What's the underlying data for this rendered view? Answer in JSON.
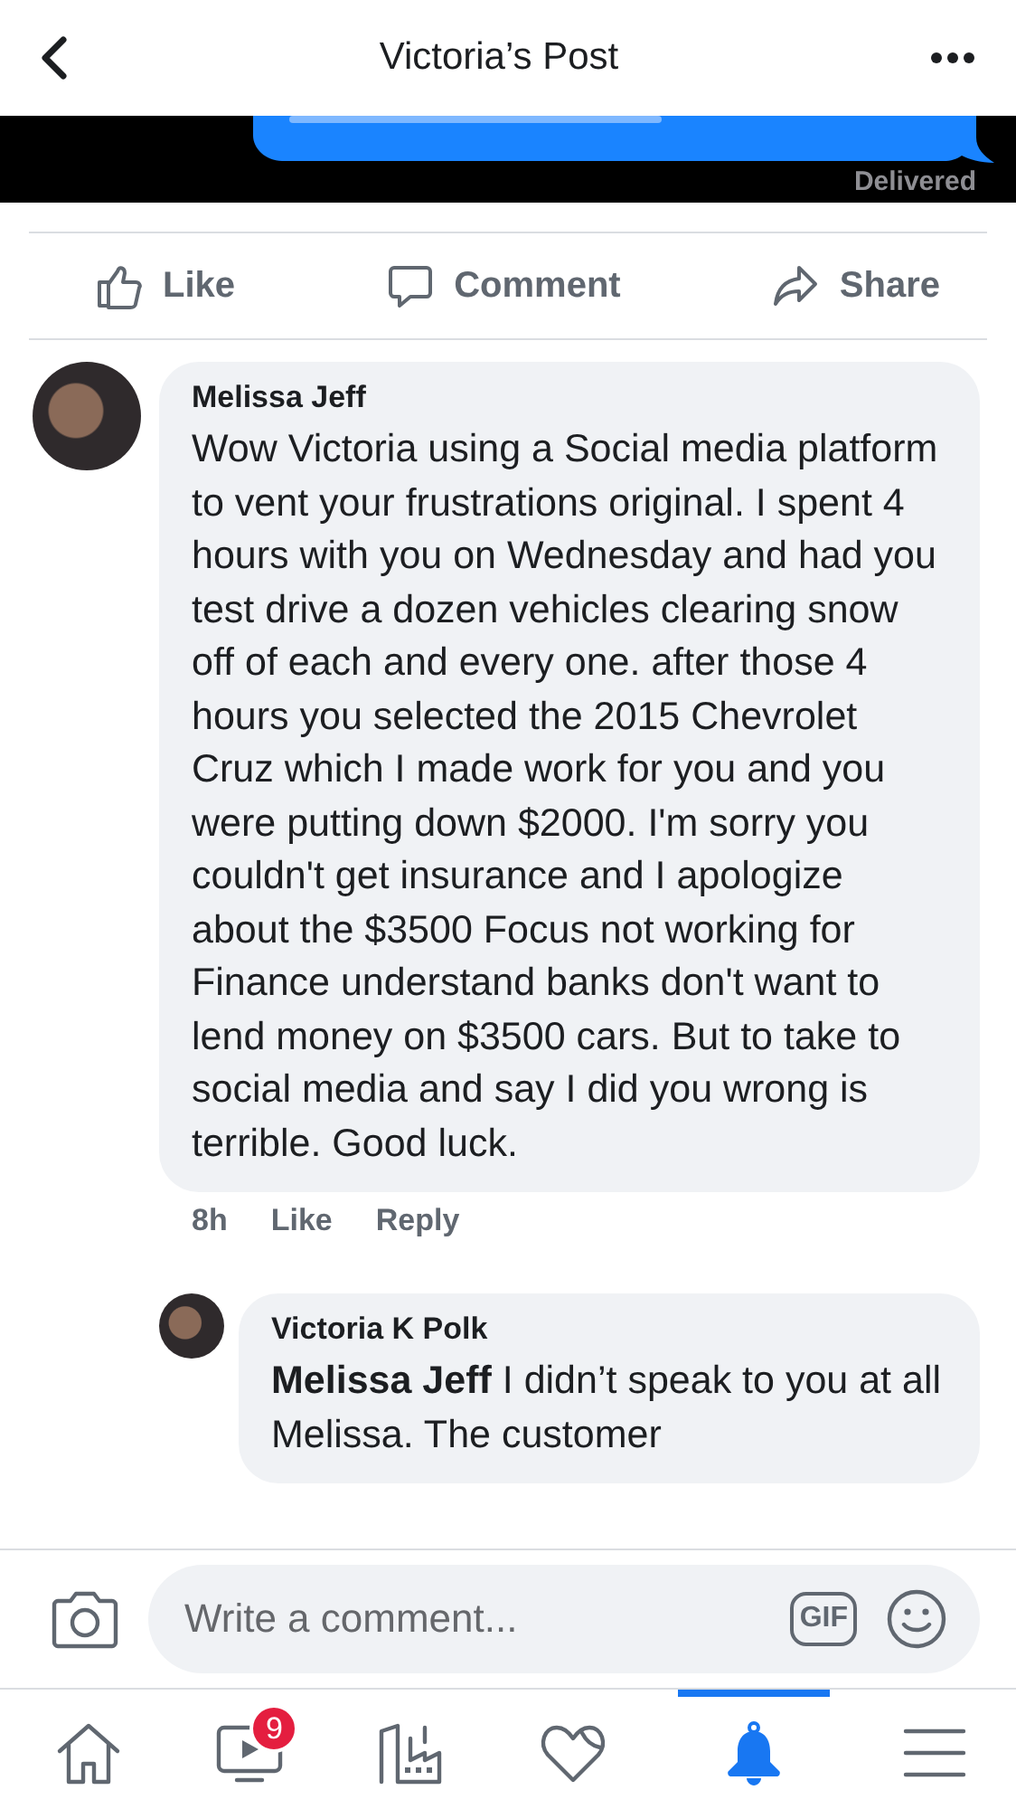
{
  "header": {
    "title": "Victoria’s Post"
  },
  "post_image": {
    "kind": "picture",
    "status": "Delivered"
  },
  "actions": [
    {
      "kind": "like",
      "label": "Like"
    },
    {
      "kind": "comment",
      "label": "Comment"
    },
    {
      "kind": "share",
      "label": "Share"
    }
  ],
  "comments": [
    {
      "author": "Melissa Jeff",
      "text": "Wow Victoria using a Social media platform to vent your frustrations original. I spent 4 hours with you on Wednesday and had you test drive a dozen vehicles clearing snow off of each and every one. after those 4 hours you selected the 2015 Chevrolet Cruz which I made work for you and you were putting down $2000. I'm sorry you couldn't get insurance and I apologize about the $3500 Focus not working for Finance understand banks don't want to lend money on $3500 cars. But to take to social media and say I did you wrong is terrible. Good luck.",
      "time": "8h",
      "like": "Like",
      "reply": "Reply",
      "replies": [
        {
          "author": "Victoria K Polk",
          "text": "**Melissa Jeff** I didn’t speak to you at all Melissa. The customer"
        }
      ]
    }
  ],
  "composer": {
    "placeholder": "Write a comment...",
    "gif": "GIF"
  },
  "tabs": [
    {
      "kind": "home",
      "selected": false
    },
    {
      "kind": "video",
      "selected": false,
      "badge": "9"
    },
    {
      "kind": "marketplace",
      "selected": false
    },
    {
      "kind": "dating",
      "selected": false
    },
    {
      "kind": "notifications",
      "selected": true
    },
    {
      "kind": "menu",
      "selected": false
    }
  ]
}
